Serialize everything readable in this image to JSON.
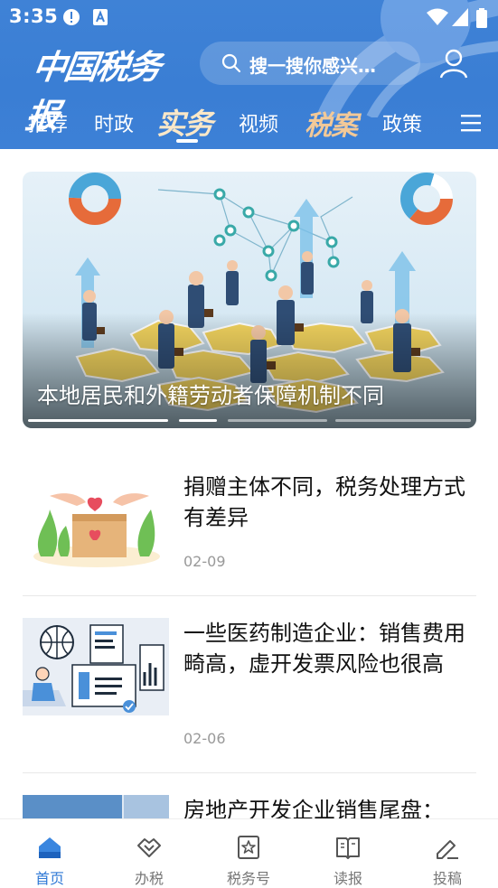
{
  "status_bar": {
    "time": "3:35"
  },
  "header": {
    "brand": "中国税务报",
    "search_placeholder": "搜一搜你感兴…",
    "tabs": [
      {
        "label": "推荐"
      },
      {
        "label": "时政"
      },
      {
        "label": "实务",
        "active": true
      },
      {
        "label": "视频"
      },
      {
        "label": "税案"
      },
      {
        "label": "政策"
      }
    ]
  },
  "banner": {
    "caption": "本地居民和外籍劳动者保障机制不同",
    "slide_count": 4,
    "active_slide": 2
  },
  "articles": [
    {
      "title": "捐赠主体不同，税务处理方式有差异",
      "date": "02-09"
    },
    {
      "title": "一些医药制造企业：销售费用畸高，虚开发票风险也很高",
      "date": "02-06"
    },
    {
      "title": "房地产开发企业销售尾盘："
    }
  ],
  "bottom_nav": [
    {
      "label": "首页",
      "icon": "home-icon",
      "active": true
    },
    {
      "label": "办税",
      "icon": "handshake-icon"
    },
    {
      "label": "税务号",
      "icon": "star-badge-icon"
    },
    {
      "label": "读报",
      "icon": "book-icon"
    },
    {
      "label": "投稿",
      "icon": "pen-icon"
    }
  ],
  "colors": {
    "header_blue": "#3d80d6",
    "active_tab": "#fbe8c8",
    "nav_active": "#2f79d6"
  }
}
